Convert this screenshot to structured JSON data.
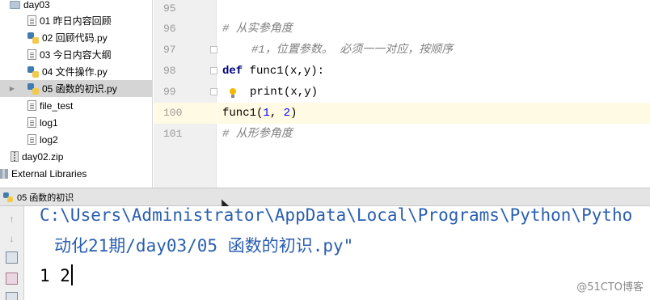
{
  "project_tree": {
    "items": [
      {
        "label": "day03",
        "icon": "folder-icon"
      },
      {
        "label": "01 昨日内容回顾",
        "icon": "text-file-icon"
      },
      {
        "label": "02 回顾代码.py",
        "icon": "python-file-icon"
      },
      {
        "label": "03 今日内容大纲",
        "icon": "text-file-icon"
      },
      {
        "label": "04 文件操作.py",
        "icon": "python-file-icon"
      },
      {
        "label": "05 函数的初识.py",
        "icon": "python-file-icon",
        "selected": true
      },
      {
        "label": "file_test",
        "icon": "text-file-icon"
      },
      {
        "label": "log1",
        "icon": "text-file-icon"
      },
      {
        "label": "log2",
        "icon": "text-file-icon"
      },
      {
        "label": "day02.zip",
        "icon": "zip-file-icon"
      },
      {
        "label": "External Libraries",
        "icon": "library-icon"
      }
    ]
  },
  "editor": {
    "current_line": "100",
    "lines": [
      {
        "number": "95",
        "text": ""
      },
      {
        "number": "96",
        "comment": "# 从实参角度"
      },
      {
        "number": "97",
        "comment": "#1，位置参数。 必须一一对应，按顺序"
      },
      {
        "number": "98",
        "keyword": "def",
        "text": " func1(x,y):"
      },
      {
        "number": "99",
        "text": "print(x,y)"
      },
      {
        "number": "100",
        "text_before": "func1(",
        "num1": "1",
        "sep": ", ",
        "num2": "2",
        "text_after": ")"
      },
      {
        "number": "101",
        "comment": "# 从形参角度"
      }
    ]
  },
  "run": {
    "tab_label": "05 函数的初识",
    "console": {
      "path_line1": "C:\\Users\\Administrator\\AppData\\Local\\Programs\\Python\\Pytho",
      "path_line2": "动化21期/day03/05 函数的初识.py\"",
      "output": "1 2"
    },
    "tools": [
      "up-arrow-icon",
      "down-arrow-icon",
      "soft-wrap-icon",
      "print-icon",
      "trash-icon"
    ]
  },
  "watermark": "@51CTO博客",
  "colors": {
    "current_line_bg": "#fffae3",
    "selection_bg": "#d5d5d5",
    "keyword": "#000080",
    "number": "#0000ff",
    "comment": "#808080",
    "console_path": "#2a5eb0"
  }
}
